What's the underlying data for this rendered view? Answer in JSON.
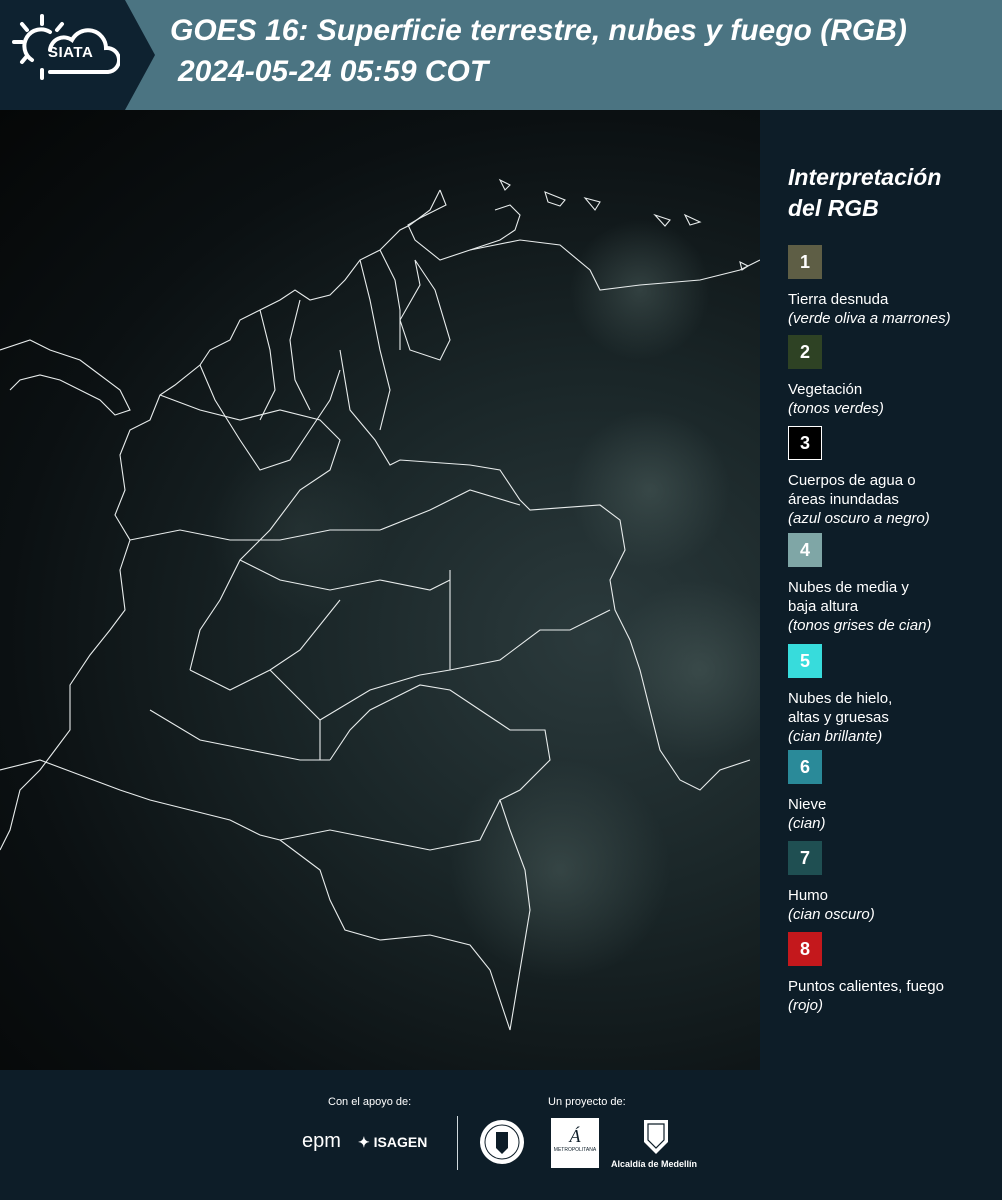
{
  "header": {
    "logo_text": "SIATA",
    "title_line1": "GOES 16: Superficie terrestre, nubes y fuego (RGB)",
    "title_line2": "2024-05-24 05:59 COT"
  },
  "legend": {
    "title_line1": "Interpretación",
    "title_line2": "del RGB",
    "items": [
      {
        "number": "1",
        "color": "#5e5e45",
        "label": "Tierra desnuda",
        "sub": "(verde oliva a marrones)"
      },
      {
        "number": "2",
        "color": "#2e4224",
        "label": "Vegetación",
        "sub": "(tonos verdes)"
      },
      {
        "number": "3",
        "color": "#000000",
        "label": "Cuerpos de agua o áreas inundadas",
        "sub": "(azul oscuro a negro)"
      },
      {
        "number": "4",
        "color": "#7fa6a6",
        "label": "Nubes de media y baja altura",
        "sub": "(tonos grises de cian)"
      },
      {
        "number": "5",
        "color": "#37dcdc",
        "label": "Nubes de hielo, altas y gruesas",
        "sub": "(cian brillante)"
      },
      {
        "number": "6",
        "color": "#2a8a99",
        "label": "Nieve",
        "sub": "(cian)"
      },
      {
        "number": "7",
        "color": "#1f4f52",
        "label": "Humo",
        "sub": "(cian oscuro)"
      },
      {
        "number": "8",
        "color": "#c4181c",
        "label": "Puntos calientes, fuego",
        "sub": "(rojo)"
      }
    ]
  },
  "footer": {
    "support_label": "Con el apoyo de:",
    "project_label": "Un proyecto de:",
    "epm": "epm",
    "isagen": "ISAGEN",
    "area_metro": "METROPOLITANA",
    "alcaldia": "Alcaldía de Medellín"
  }
}
